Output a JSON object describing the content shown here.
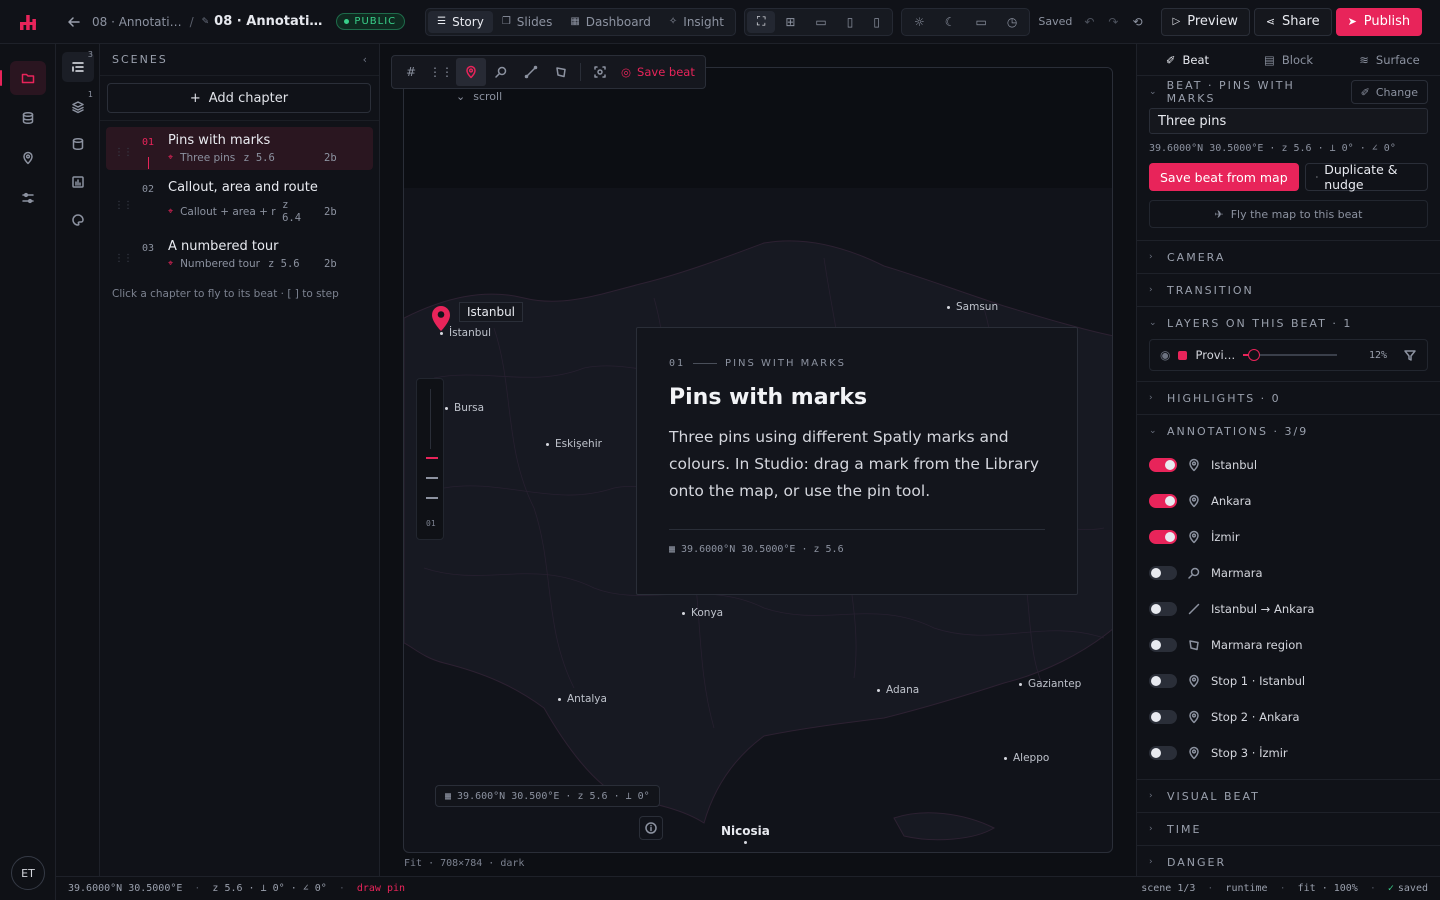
{
  "topbar": {
    "crumb_parent": "08 · Annotati…",
    "crumb_current": "08 · Annotati…",
    "visibility": "PUBLIC",
    "modes": [
      "Story",
      "Slides",
      "Dashboard",
      "Insight"
    ],
    "active_mode": "Story",
    "saved": "Saved",
    "preview": "Preview",
    "share": "Share",
    "publish": "Publish"
  },
  "user": {
    "initials": "ET"
  },
  "rail2": {
    "scenes_count": "3",
    "layers_count": "1"
  },
  "scenes": {
    "title": "SCENES",
    "add_chapter": "Add chapter",
    "chapters": [
      {
        "num": "01",
        "title": "Pins with marks",
        "sub": "Three pins",
        "zoom": "z 5.6",
        "beats": "2b"
      },
      {
        "num": "02",
        "title": "Callout, area and route",
        "sub": "Callout + area + r…",
        "zoom": "z 6.4",
        "beats": "2b"
      },
      {
        "num": "03",
        "title": "A numbered tour",
        "sub": "Numbered tour",
        "zoom": "z 5.6",
        "beats": "2b"
      }
    ],
    "hint": "Click a chapter to fly to its beat · [ ] to step"
  },
  "canvas": {
    "save_beat": "Save beat",
    "scroll": "scroll",
    "pin_label": "Istanbul",
    "cities": [
      "Samsun",
      "İstanbul",
      "Bursa",
      "Eskişehir",
      "Konya",
      "Antalya",
      "Adana",
      "Gaziantep",
      "Aleppo",
      "Nicosia"
    ],
    "scrubber_index": "01",
    "card": {
      "num": "01",
      "eyebrow": "PINS WITH MARKS",
      "title": "Pins with marks",
      "body": "Three pins using different Spatly marks and colours. In Studio: drag a mark from the Library onto the map, or use the pin tool.",
      "coords": "39.6000°N 30.5000°E · z 5.6"
    },
    "coord_readout": "39.600°N 30.500°E · z 5.6 · ⟂ 0°",
    "footer": "Fit · 708×784 · dark"
  },
  "right": {
    "tabs": [
      "Beat",
      "Block",
      "Surface"
    ],
    "active_tab": "Beat",
    "beat_header": "BEAT · PINS WITH MARKS",
    "change": "Change",
    "beat_name": "Three pins",
    "beat_coords": "39.6000°N 30.5000°E · z 5.6 · ⟂ 0° · ∠ 0°",
    "save_beat_from_map": "Save beat from map",
    "duplicate_nudge": "Duplicate & nudge",
    "fly_to_beat": "Fly the map to this beat",
    "camera": "CAMERA",
    "transition": "TRANSITION",
    "layers_header": "LAYERS ON THIS BEAT · 1",
    "layer": {
      "name": "Provi…",
      "opacity": 12,
      "opacity_label": "12%",
      "color": "#e8245a"
    },
    "highlights": "HIGHLIGHTS · 0",
    "annotations_header": "ANNOTATIONS · 3/9",
    "annotations": [
      {
        "label": "Istanbul",
        "on": true,
        "icon": "pin-icon"
      },
      {
        "label": "Ankara",
        "on": true,
        "icon": "pin-icon"
      },
      {
        "label": "İzmir",
        "on": true,
        "icon": "pin-icon"
      },
      {
        "label": "Marmara",
        "on": false,
        "icon": "callout-icon"
      },
      {
        "label": "Istanbul → Ankara",
        "on": false,
        "icon": "route-icon"
      },
      {
        "label": "Marmara region",
        "on": false,
        "icon": "area-icon"
      },
      {
        "label": "Stop 1 · Istanbul",
        "on": false,
        "icon": "pin-icon"
      },
      {
        "label": "Stop 2 · Ankara",
        "on": false,
        "icon": "pin-icon"
      },
      {
        "label": "Stop 3 · İzmir",
        "on": false,
        "icon": "pin-icon"
      }
    ],
    "visual_beat": "VISUAL BEAT",
    "time": "TIME",
    "danger": "DANGER"
  },
  "status": {
    "coords": "39.6000°N 30.5000°E",
    "view": "z 5.6 · ⟂ 0° · ∠ 0°",
    "tool": "draw pin",
    "scene": "scene 1/3",
    "runtime": "runtime",
    "fit": "fit · 100%",
    "saved": "saved"
  },
  "colors": {
    "accent": "#e8245a",
    "success": "#39d08a",
    "bg": "#0d0f14"
  }
}
